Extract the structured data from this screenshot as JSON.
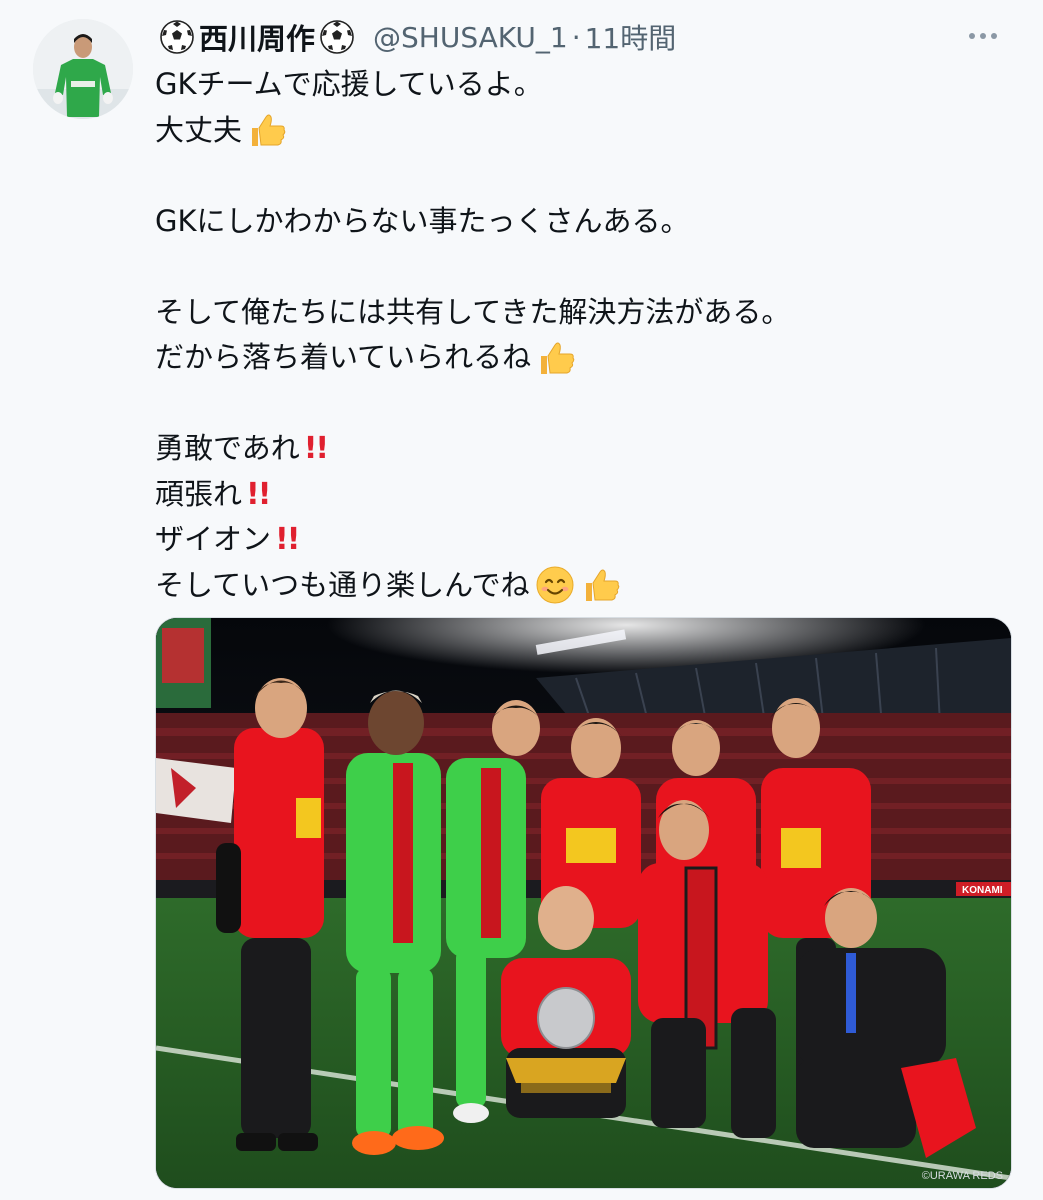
{
  "author": {
    "display_name": "西川周作",
    "handle": "@SHUSAKU_1",
    "separator": "·",
    "time": "11時間"
  },
  "tweet": {
    "lines": [
      "GKチームで応援しているよ。",
      "大丈夫",
      "",
      "GKにしかわからない事たっくさんある。",
      "",
      "そして俺たちには共有してきた解決方法がある。",
      "だから落ち着いていられるね",
      "",
      "勇敢であれ",
      "頑張れ",
      "ザイオン",
      "そしていつも通り楽しんでね"
    ]
  },
  "photo": {
    "credit": "©URAWA REDS",
    "board_text": "KONAMI"
  },
  "icons": {
    "ball": "soccer-ball-icon",
    "thumbs": "thumbs-up-icon",
    "bang": "double-exclamation-icon",
    "smile": "smiling-face-icon",
    "more": "more-options-icon"
  },
  "colors": {
    "text": "#0f1419",
    "secondary": "#536471",
    "exclamation": "#e0202f",
    "kit_red": "#e8141e",
    "gk_green": "#3ecf4a"
  }
}
